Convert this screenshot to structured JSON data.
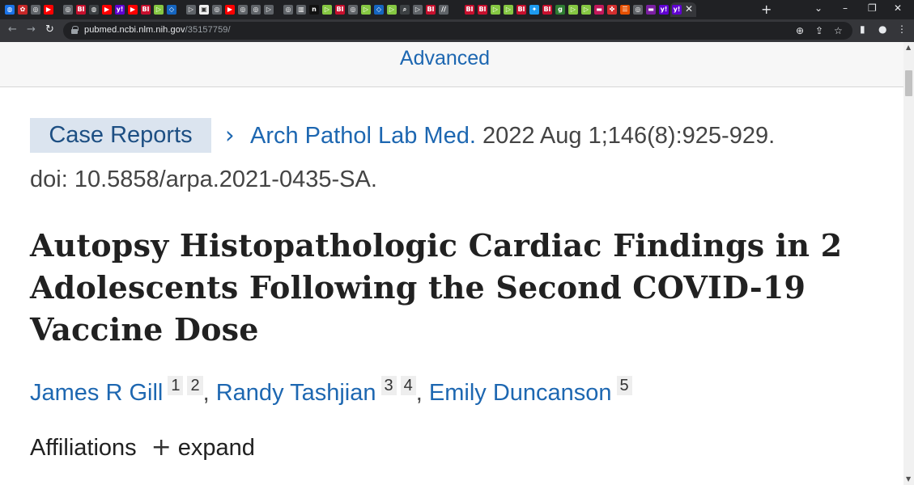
{
  "browser": {
    "tab_favicons": [
      {
        "icon": "globe-favicon",
        "color": "#1a73e8",
        "glyph": "◍"
      },
      {
        "icon": "poker-chip-favicon",
        "color": "#c62828",
        "glyph": "✿"
      },
      {
        "icon": "openai-favicon",
        "color": "#5f6368",
        "glyph": "◎"
      },
      {
        "icon": "youtube-favicon",
        "color": "#ff0000",
        "glyph": "▶"
      },
      {
        "icon": "gap"
      },
      {
        "icon": "openai-favicon",
        "color": "#5f6368",
        "glyph": "◎"
      },
      {
        "icon": "business-insider-favicon",
        "color": "#c8102e",
        "glyph": "BI"
      },
      {
        "icon": "globe-favicon",
        "color": "#3c4043",
        "glyph": "◍"
      },
      {
        "icon": "youtube-favicon",
        "color": "#ff0000",
        "glyph": "▶"
      },
      {
        "icon": "yahoo-favicon",
        "color": "#6001d2",
        "glyph": "y!"
      },
      {
        "icon": "youtube-favicon",
        "color": "#ff0000",
        "glyph": "▶"
      },
      {
        "icon": "business-insider-favicon",
        "color": "#c8102e",
        "glyph": "BI"
      },
      {
        "icon": "rumble-favicon",
        "color": "#85c742",
        "glyph": "▷"
      },
      {
        "icon": "shield-favicon",
        "color": "#1565c0",
        "glyph": "◇"
      },
      {
        "icon": "gap"
      },
      {
        "icon": "play-favicon",
        "color": "#5f6368",
        "glyph": "▷"
      },
      {
        "icon": "image-favicon",
        "color": "#eeeeee",
        "glyph": "▣"
      },
      {
        "icon": "openai-favicon",
        "color": "#5f6368",
        "glyph": "◎"
      },
      {
        "icon": "youtube-favicon",
        "color": "#ff0000",
        "glyph": "▶"
      },
      {
        "icon": "openai-favicon",
        "color": "#5f6368",
        "glyph": "◎"
      },
      {
        "icon": "openai-favicon",
        "color": "#5f6368",
        "glyph": "◎"
      },
      {
        "icon": "play-favicon",
        "color": "#5f6368",
        "glyph": "▷"
      },
      {
        "icon": "gap"
      },
      {
        "icon": "openai-favicon",
        "color": "#5f6368",
        "glyph": "◎"
      },
      {
        "icon": "substack-favicon",
        "color": "#5f6368",
        "glyph": "▥"
      },
      {
        "icon": "notion-favicon",
        "color": "#111111",
        "glyph": "n"
      },
      {
        "icon": "rumble-favicon",
        "color": "#85c742",
        "glyph": "▷"
      },
      {
        "icon": "business-insider-favicon",
        "color": "#c8102e",
        "glyph": "BI"
      },
      {
        "icon": "openai-favicon",
        "color": "#5f6368",
        "glyph": "◎"
      },
      {
        "icon": "rumble-favicon",
        "color": "#85c742",
        "glyph": "▷"
      },
      {
        "icon": "shield-favicon",
        "color": "#1565c0",
        "glyph": "◇"
      },
      {
        "icon": "rumble-favicon",
        "color": "#85c742",
        "glyph": "▷"
      },
      {
        "icon": "search-favicon",
        "color": "#3c4043",
        "glyph": "⌕"
      },
      {
        "icon": "play-favicon",
        "color": "#5f6368",
        "glyph": "▷"
      },
      {
        "icon": "business-insider-favicon",
        "color": "#c8102e",
        "glyph": "BI"
      },
      {
        "icon": "page-favicon",
        "color": "#5f6368",
        "glyph": "//"
      },
      {
        "icon": "gap"
      },
      {
        "icon": "gap"
      },
      {
        "icon": "business-insider-favicon",
        "color": "#c8102e",
        "glyph": "BI"
      },
      {
        "icon": "business-insider-favicon",
        "color": "#c8102e",
        "glyph": "BI"
      },
      {
        "icon": "rumble-favicon",
        "color": "#85c742",
        "glyph": "▷"
      },
      {
        "icon": "rumble-favicon",
        "color": "#85c742",
        "glyph": "▷"
      },
      {
        "icon": "business-insider-favicon",
        "color": "#c8102e",
        "glyph": "BI"
      },
      {
        "icon": "twitter-favicon",
        "color": "#1d9bf0",
        "glyph": "✦"
      },
      {
        "icon": "business-insider-favicon",
        "color": "#c8102e",
        "glyph": "BI"
      },
      {
        "icon": "letter-g-favicon",
        "color": "#2e7d32",
        "glyph": "g"
      },
      {
        "icon": "rumble-favicon",
        "color": "#85c742",
        "glyph": "▷"
      },
      {
        "icon": "rumble-favicon",
        "color": "#85c742",
        "glyph": "▷"
      },
      {
        "icon": "flag-favicon",
        "color": "#c2185b",
        "glyph": "▬"
      },
      {
        "icon": "ribbon-favicon",
        "color": "#d32f2f",
        "glyph": "✤"
      },
      {
        "icon": "stack-favicon",
        "color": "#e65100",
        "glyph": "☰"
      },
      {
        "icon": "openai-favicon",
        "color": "#5f6368",
        "glyph": "◎"
      },
      {
        "icon": "flag-favicon",
        "color": "#7b1fa2",
        "glyph": "▬"
      },
      {
        "icon": "yahoo-favicon",
        "color": "#6001d2",
        "glyph": "y!"
      }
    ],
    "active_tab_close": "✕",
    "new_tab": "+",
    "window_controls": {
      "dropdown": "⌄",
      "minimize": "–",
      "maximize": "❐",
      "close": "✕"
    },
    "nav": {
      "back": "←",
      "forward": "→",
      "reload": "↻"
    },
    "url_host": "pubmed.ncbi.nlm.nih.gov",
    "url_path": "/35157759/",
    "toolbar_icons": {
      "zoom": "⊕",
      "share": "⇪",
      "bookmark": "☆",
      "sidepanel": "▮",
      "profile": "●",
      "menu": "⋮"
    }
  },
  "search": {
    "advanced_label": "Advanced"
  },
  "article": {
    "publication_type": "Case Reports",
    "chevron": "›",
    "journal": "Arch Pathol Lab Med.",
    "citation": " 2022 Aug 1;146(8):925-929.",
    "doi": "doi: 10.5858/arpa.2021-0435-SA.",
    "title": "Autopsy Histopathologic Cardiac Findings in 2 Adolescents Following the Second COVID-19 Vaccine Dose",
    "authors": [
      {
        "name": "James R Gill",
        "affiliations": [
          "1",
          "2"
        ]
      },
      {
        "name": "Randy Tashjian",
        "affiliations": [
          "3",
          "4"
        ]
      },
      {
        "name": "Emily Duncanson",
        "affiliations": [
          "5"
        ]
      }
    ],
    "author_separator": ", ",
    "affiliations_label": "Affiliations",
    "expand_icon": "+",
    "expand_label": "expand"
  },
  "colors": {
    "link": "#1d67b1",
    "badge_bg": "#dbe4ef",
    "browser_dark": "#202124",
    "toolbar": "#35363a"
  }
}
